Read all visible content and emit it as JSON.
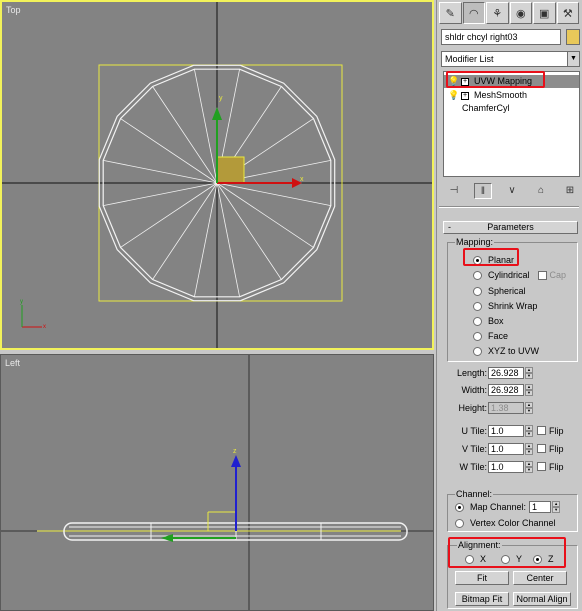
{
  "viewports": {
    "top": {
      "label": "Top"
    },
    "left": {
      "label": "Left"
    }
  },
  "axes": {
    "x": "x",
    "y": "y",
    "z": "z"
  },
  "panel": {
    "tabs": [
      {
        "icon": "create-icon"
      },
      {
        "icon": "modify-icon"
      },
      {
        "icon": "hierarchy-icon"
      },
      {
        "icon": "motion-icon"
      },
      {
        "icon": "display-icon"
      },
      {
        "icon": "utilities-icon"
      }
    ],
    "object_name": "shldr chcyl right03",
    "object_color": "#e8c85a",
    "modifier_list": "Modifier List",
    "stack": [
      {
        "label": "UVW Mapping",
        "selected": true
      },
      {
        "label": "MeshSmooth",
        "selected": false
      },
      {
        "label": "ChamferCyl",
        "selected": false
      }
    ],
    "rollout": {
      "sign": "-",
      "title": "Parameters"
    },
    "mapping": {
      "title": "Mapping:",
      "options": [
        "Planar",
        "Cylindrical",
        "Spherical",
        "Shrink Wrap",
        "Box",
        "Face",
        "XYZ to UVW"
      ],
      "selected": "Planar",
      "cap_label": "Cap"
    },
    "dimensions": {
      "length_label": "Length:",
      "length_value": "26.928",
      "width_label": "Width:",
      "width_value": "26.928",
      "height_label": "Height:",
      "height_value": "1.38"
    },
    "tiles": {
      "u_label": "U Tile:",
      "u_value": "1.0",
      "v_label": "V Tile:",
      "v_value": "1.0",
      "w_label": "W Tile:",
      "w_value": "1.0",
      "flip_label": "Flip"
    },
    "channel": {
      "title": "Channel:",
      "map_channel_label": "Map Channel:",
      "map_channel_value": "1",
      "vertex_color_label": "Vertex Color Channel"
    },
    "alignment": {
      "title": "Alignment:",
      "x": "X",
      "y": "Y",
      "z": "Z",
      "selected": "Z"
    },
    "buttons": {
      "fit": "Fit",
      "center": "Center",
      "bitmap_fit": "Bitmap Fit",
      "normal_align": "Normal Align"
    }
  },
  "colors": {
    "viewport_bg": "#838383",
    "active_border": "#f2f25a",
    "highlight": "#e8101a"
  }
}
